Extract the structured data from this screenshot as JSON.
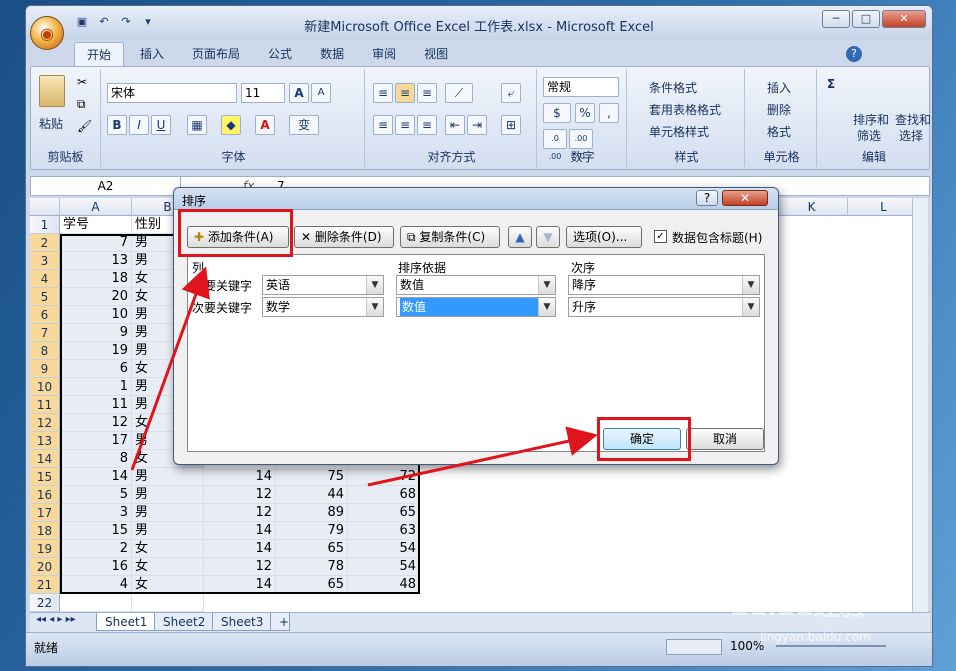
{
  "window": {
    "title": "新建Microsoft Office Excel 工作表.xlsx - Microsoft Excel",
    "office_button_icon": "office-logo-icon",
    "min": "─",
    "max": "□",
    "close": "✕",
    "help": "?"
  },
  "qat": {
    "save_icon": "save-icon",
    "undo_icon": "undo-icon",
    "redo_icon": "redo-icon"
  },
  "tabs": [
    "开始",
    "插入",
    "页面布局",
    "公式",
    "数据",
    "审阅",
    "视图"
  ],
  "ribbon": {
    "clipboard": {
      "label": "剪贴板",
      "paste": "粘贴"
    },
    "font": {
      "label": "字体",
      "name": "宋体",
      "size": "11",
      "bold": "B",
      "italic": "I",
      "underline": "U",
      "grow": "A",
      "shrink": "A",
      "font_color": "A",
      "phonetic": "变"
    },
    "alignment": {
      "label": "对齐方式"
    },
    "number": {
      "label": "数字",
      "format": "常规",
      "percent": "%",
      "comma": ",",
      "inc_decimal": ".0 .00",
      "dec_decimal": ".00 .0"
    },
    "styles": {
      "label": "样式",
      "conditional": "条件格式",
      "table": "套用表格格式",
      "cell_styles": "单元格样式"
    },
    "cells": {
      "label": "单元格",
      "insert": "插入",
      "delete": "删除",
      "format": "格式"
    },
    "editing": {
      "label": "编辑",
      "sum": "Σ",
      "sort": "排序和",
      "sort2": "筛选",
      "find": "查找和",
      "find2": "选择"
    }
  },
  "formula_bar": {
    "name_box": "A2",
    "fx": "fx",
    "value": "7"
  },
  "columns": [
    "A",
    "B",
    "K",
    "L"
  ],
  "headers": {
    "a": "学号",
    "b": "性别"
  },
  "rows": [
    {
      "n": "1",
      "a": "",
      "b": "",
      "c": "",
      "d": "",
      "e": ""
    },
    {
      "n": "2",
      "a": "7",
      "b": "男"
    },
    {
      "n": "3",
      "a": "13",
      "b": "男"
    },
    {
      "n": "4",
      "a": "18",
      "b": "女"
    },
    {
      "n": "5",
      "a": "20",
      "b": "女"
    },
    {
      "n": "6",
      "a": "10",
      "b": "男"
    },
    {
      "n": "7",
      "a": "9",
      "b": "男"
    },
    {
      "n": "8",
      "a": "19",
      "b": "男"
    },
    {
      "n": "9",
      "a": "6",
      "b": "女"
    },
    {
      "n": "10",
      "a": "1",
      "b": "男"
    },
    {
      "n": "11",
      "a": "11",
      "b": "男"
    },
    {
      "n": "12",
      "a": "12",
      "b": "女"
    },
    {
      "n": "13",
      "a": "17",
      "b": "男"
    },
    {
      "n": "14",
      "a": "8",
      "b": "女"
    },
    {
      "n": "15",
      "a": "14",
      "b": "男",
      "c": "14",
      "d": "75",
      "e": "72"
    },
    {
      "n": "16",
      "a": "5",
      "b": "男",
      "c": "12",
      "d": "44",
      "e": "68"
    },
    {
      "n": "17",
      "a": "3",
      "b": "男",
      "c": "12",
      "d": "89",
      "e": "65"
    },
    {
      "n": "18",
      "a": "15",
      "b": "男",
      "c": "14",
      "d": "79",
      "e": "63"
    },
    {
      "n": "19",
      "a": "2",
      "b": "女",
      "c": "14",
      "d": "65",
      "e": "54"
    },
    {
      "n": "20",
      "a": "16",
      "b": "女",
      "c": "12",
      "d": "78",
      "e": "54"
    },
    {
      "n": "21",
      "a": "4",
      "b": "女",
      "c": "14",
      "d": "65",
      "e": "48"
    },
    {
      "n": "22",
      "a": "",
      "b": ""
    }
  ],
  "sheets": [
    "Sheet1",
    "Sheet2",
    "Sheet3"
  ],
  "status": {
    "ready": "就绪",
    "zoom": "100%"
  },
  "dialog": {
    "title": "排序",
    "help": "?",
    "close": "✕",
    "add": "添加条件(A)",
    "delete": "删除条件(D)",
    "copy": "复制条件(C)",
    "options": "选项(O)...",
    "has_header": "数据包含标题(H)",
    "has_header_checked": true,
    "col_header": "列",
    "sort_on_header": "排序依据",
    "order_header": "次序",
    "conditions": [
      {
        "label": "主要关键字",
        "column": "英语",
        "sort_on": "数值",
        "order": "降序"
      },
      {
        "label": "次要关键字",
        "column": "数学",
        "sort_on": "数值",
        "order": "升序"
      }
    ],
    "ok": "确定",
    "cancel": "取消"
  },
  "watermark": "Baidu经验",
  "watermark_url": "jingyan.baidu.com",
  "accent": "#e0141c"
}
